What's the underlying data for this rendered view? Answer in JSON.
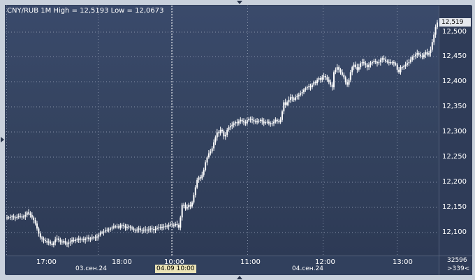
{
  "header": {
    "title": "CNY/RUB 1M High = 12,5193 Low = 12,0673",
    "current_price": "12,519"
  },
  "y_axis": {
    "labels": [
      "12,500",
      "12,450",
      "12,400",
      "12,350",
      "12,300",
      "12,250",
      "12,200",
      "12,150",
      "12,100"
    ]
  },
  "x_axis": {
    "time_labels": [
      "17:00",
      "18:00",
      "10:00",
      "11:00",
      "12:00",
      "13:00"
    ],
    "date_labels": [
      "03.сен.24",
      "04.сен.24"
    ],
    "cursor_label": "04.09 10:00"
  },
  "corner": {
    "count": "32596",
    "shift": ">339<"
  },
  "colors": {
    "background": "#34435f",
    "candles": "#ffffff",
    "frame": "#c9d1dc"
  },
  "chart_data": {
    "type": "candlestick",
    "title": "CNY/RUB 1M High = 12,5193 Low = 12,0673",
    "ylim": [
      12.075,
      12.53
    ],
    "x_ticks": [
      "17:00",
      "18:00",
      "10:00",
      "11:00",
      "12:00",
      "13:00"
    ],
    "y_ticks": [
      12.5,
      12.45,
      12.4,
      12.35,
      12.3,
      12.25,
      12.2,
      12.15,
      12.1
    ],
    "series": [
      {
        "values": [
          12.13,
          12.13,
          12.131,
          12.132,
          12.13,
          12.129,
          12.131,
          12.133,
          12.132,
          12.13,
          12.132,
          12.135,
          12.14,
          12.138,
          12.135,
          12.13,
          12.125,
          12.118,
          12.108,
          12.098,
          12.09,
          12.088,
          12.085,
          12.083,
          12.08,
          12.082,
          12.078,
          12.075,
          12.08,
          12.086,
          12.088,
          12.085,
          12.082,
          12.08,
          12.083,
          12.078,
          12.077,
          12.08,
          12.082,
          12.085,
          12.083,
          12.086,
          12.085,
          12.088,
          12.086,
          12.087,
          12.085,
          12.088,
          12.09,
          12.087,
          12.088,
          12.09,
          12.089,
          12.09,
          12.092,
          12.095,
          12.1,
          12.1,
          12.102,
          12.104,
          12.105,
          12.106,
          12.108,
          12.11,
          12.112,
          12.111,
          12.112,
          12.11,
          12.114,
          12.115,
          12.113,
          12.11,
          12.111,
          12.112,
          12.11,
          12.108,
          12.105,
          12.104,
          12.106,
          12.108,
          12.105,
          12.104,
          12.105,
          12.106,
          12.104,
          12.106,
          12.108,
          12.107,
          12.105,
          12.107,
          12.109,
          12.11,
          12.111,
          12.11,
          12.112,
          12.113,
          12.112,
          12.115,
          12.116,
          12.115,
          12.114,
          12.117,
          12.115,
          12.11,
          12.13,
          12.155,
          12.155,
          12.148,
          12.15,
          12.155,
          12.152,
          12.16,
          12.175,
          12.19,
          12.205,
          12.21,
          12.208,
          12.215,
          12.225,
          12.24,
          12.25,
          12.258,
          12.262,
          12.268,
          12.28,
          12.29,
          12.3,
          12.298,
          12.305,
          12.302,
          12.292,
          12.295,
          12.305,
          12.31,
          12.312,
          12.315,
          12.318,
          12.32,
          12.318,
          12.322,
          12.325,
          12.322,
          12.32,
          12.318,
          12.324,
          12.327,
          12.326,
          12.325,
          12.322,
          12.32,
          12.322,
          12.323,
          12.325,
          12.322,
          12.318,
          12.32,
          12.321,
          12.318,
          12.316,
          12.318,
          12.321,
          12.325,
          12.322,
          12.32,
          12.325,
          12.342,
          12.36,
          12.355,
          12.36,
          12.365,
          12.37,
          12.368,
          12.365,
          12.37,
          12.372,
          12.375,
          12.378,
          12.38,
          12.385,
          12.388,
          12.39,
          12.392,
          12.39,
          12.395,
          12.4,
          12.398,
          12.405,
          12.408,
          12.405,
          12.41,
          12.412,
          12.41,
          12.405,
          12.4,
          12.395,
          12.39,
          12.42,
          12.425,
          12.43,
          12.425,
          12.42,
          12.415,
          12.41,
          12.4,
          12.395,
          12.405,
          12.42,
          12.43,
          12.435,
          12.43,
          12.425,
          12.43,
          12.438,
          12.44,
          12.438,
          12.435,
          12.43,
          12.435,
          12.438,
          12.44,
          12.442,
          12.44,
          12.438,
          12.44,
          12.445,
          12.448,
          12.445,
          12.442,
          12.44,
          12.44,
          12.438,
          12.44,
          12.438,
          12.435,
          12.425,
          12.42,
          12.43,
          12.43,
          12.432,
          12.435,
          12.438,
          12.44,
          12.445,
          12.45,
          12.452,
          12.455,
          12.458,
          12.455,
          12.452,
          12.45,
          12.455,
          12.46,
          12.455,
          12.458,
          12.465,
          12.48,
          12.495,
          12.51,
          12.519
        ]
      }
    ]
  }
}
